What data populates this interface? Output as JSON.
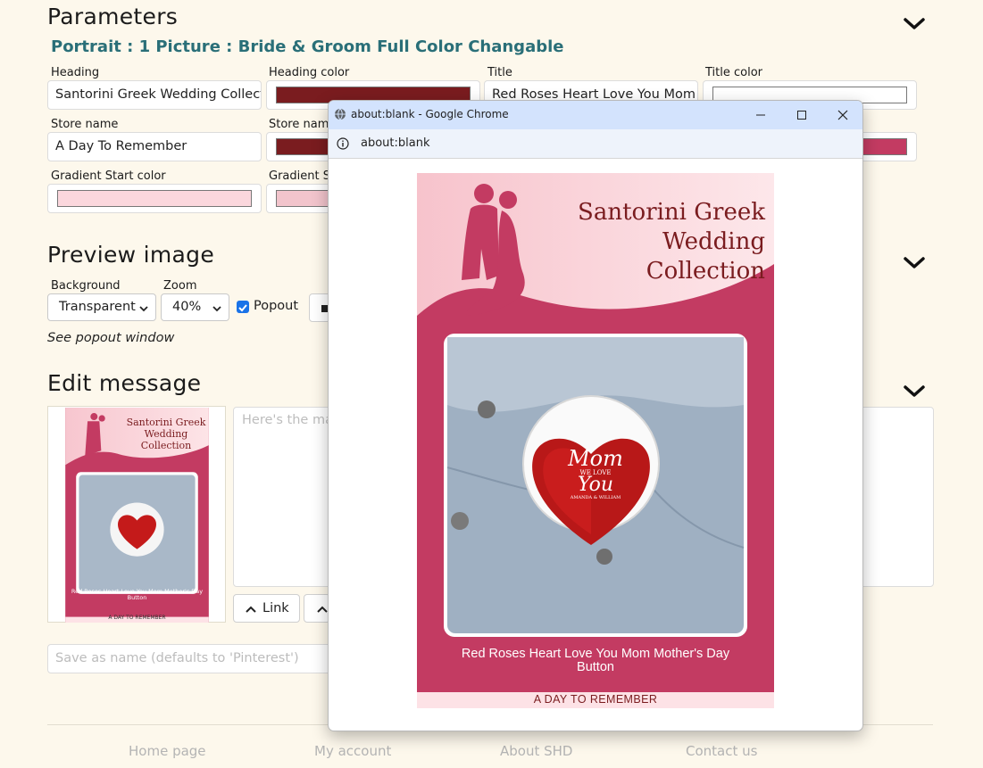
{
  "parameters": {
    "heading": "Parameters",
    "subtitle": "Portrait : 1 Picture : Bride & Groom Full Color Changable",
    "fields": {
      "heading_label": "Heading",
      "heading_value": "Santorini Greek Wedding Collecti",
      "heading_color_label": "Heading color",
      "heading_color": "#7a1c1f",
      "title_label": "Title",
      "title_value": "Red Roses Heart Love You Mom M",
      "title_color_label": "Title color",
      "title_color": "#ffffff",
      "store_name_label": "Store name",
      "store_name_value": "A Day To Remember",
      "store_name_color_label": "Store name",
      "store_name_color": "#7a1c1f",
      "accent_color": "#c33b62",
      "gradient_start_label": "Gradient Start color",
      "gradient_start_color": "#fbd7dd",
      "gradient_stop_label": "Gradient St",
      "gradient_stop_color": "#f2c4cc"
    }
  },
  "preview": {
    "heading": "Preview image",
    "background_label": "Background",
    "background_value": "Transparent",
    "zoom_label": "Zoom",
    "zoom_value": "40%",
    "popout_label": "Popout",
    "popout_checked": true,
    "note": "See popout window"
  },
  "edit": {
    "heading": "Edit message",
    "placeholder": "Here's the ma",
    "link_button": "Link",
    "save_placeholder": "Save as name (defaults to 'Pinterest')"
  },
  "footer": {
    "links": [
      "Home page",
      "My account",
      "About SHD",
      "Contact us"
    ]
  },
  "popout": {
    "window_title": "about:blank - Google Chrome",
    "address": "about:blank",
    "card": {
      "heading_line1": "Santorini Greek",
      "heading_line2": "Wedding Collection",
      "badge_line1": "Mom",
      "badge_line2": "WE LOVE",
      "badge_line3": "You",
      "badge_line4": "AMANDA & WILLIAM",
      "title_line1": "Red Roses Heart Love You Mom Mother's Day",
      "title_line2": "Button",
      "store": "A DAY TO REMEMBER"
    }
  }
}
